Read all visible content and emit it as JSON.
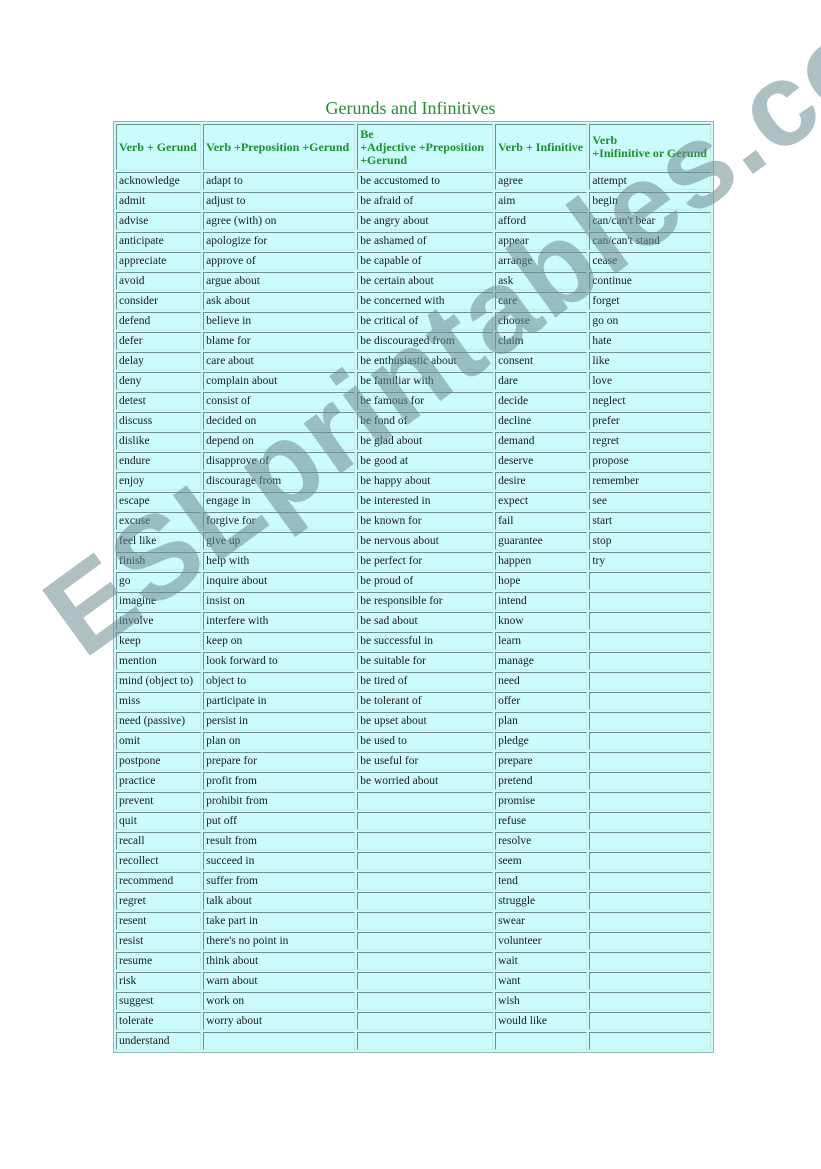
{
  "title": "Gerunds and Infinitives",
  "watermark": "ESLprintables.com",
  "headers": [
    "Verb + Gerund",
    "Verb +Preposition +Gerund",
    "Be +Adjective +Preposition +Gerund",
    "Verb + Infinitive",
    "Verb +Inifinitive or Gerund"
  ],
  "columns": {
    "verb_gerund": [
      "acknowledge",
      "admit",
      "advise",
      "anticipate",
      "appreciate",
      "avoid",
      "consider",
      "defend",
      "defer",
      "delay",
      "deny",
      "detest",
      "discuss",
      "dislike",
      "endure",
      "enjoy",
      "escape",
      "excuse",
      "feel like",
      "finish",
      "go",
      "imagine",
      "involve",
      "keep",
      "mention",
      "mind (object to)",
      "miss",
      "need (passive)",
      "omit",
      "postpone",
      "practice",
      "prevent",
      "quit",
      "recall",
      "recollect",
      "recommend",
      "regret",
      "resent",
      "resist",
      "resume",
      "risk",
      "suggest",
      "tolerate",
      "understand"
    ],
    "verb_prep_gerund": [
      "adapt to",
      "adjust to",
      "agree (with) on",
      " apologize for",
      "approve of",
      "argue about",
      "ask about",
      "believe in",
      "blame for",
      "care about",
      "complain about",
      "consist of",
      "decided on",
      "depend on",
      "disapprove of",
      "discourage from",
      "engage in",
      "forgive for",
      "give up",
      "help with",
      "inquire about",
      "insist on",
      "interfere with",
      "keep on",
      "look forward to",
      "object to",
      "participate in",
      "persist in",
      "plan on",
      "prepare for",
      "profit from",
      "prohibit from",
      "put off",
      "result from",
      "succeed in",
      "suffer from",
      "talk about",
      "take part in",
      "there's no point in",
      "think about",
      "warn about",
      "work on",
      "worry about",
      ""
    ],
    "be_adj_prep_gerund": [
      "be accustomed to",
      "be afraid of",
      "be angry about",
      "be ashamed of",
      "be capable of",
      "be certain about",
      "be concerned with",
      "be critical of",
      "be discouraged from",
      "be enthusiastic about",
      "be familiar with",
      "be famous for",
      "be fond of",
      "be glad about",
      "be good at",
      "be happy about",
      "be interested in",
      "be known for",
      "be nervous about",
      "be perfect for",
      "be proud of",
      "be responsible for",
      "be sad about",
      "be successful in",
      "be suitable for",
      "be tired of",
      "be tolerant of",
      "be upset about",
      "be used to",
      "be useful for",
      "be worried about",
      "",
      "",
      "",
      "",
      "",
      "",
      "",
      "",
      "",
      "",
      "",
      "",
      ""
    ],
    "verb_infinitive": [
      "agree",
      "aim",
      "afford",
      "appear",
      "arrange",
      "ask",
      "care",
      "choose",
      "claim",
      "consent",
      "dare",
      "decide",
      "decline",
      "demand",
      "deserve",
      "desire",
      "expect",
      "fail",
      "guarantee",
      "happen",
      "hope",
      "intend",
      "know",
      "learn",
      "manage",
      "need",
      "offer",
      "plan",
      "pledge",
      "prepare",
      "pretend",
      "promise",
      "refuse",
      "resolve",
      "seem",
      "tend",
      "struggle",
      "swear",
      "volunteer",
      "wait",
      "want",
      "wish",
      "would like",
      ""
    ],
    "verb_inf_or_gerund": [
      "attempt",
      "begin",
      "can/can't bear",
      "can/can't stand",
      "cease",
      "continue",
      "forget",
      "go on",
      "hate",
      "like",
      "love",
      "neglect",
      "prefer",
      "regret",
      "propose",
      "remember",
      "see",
      "start",
      "stop",
      "try",
      "",
      "",
      "",
      "",
      "",
      "",
      "",
      "",
      "",
      "",
      "",
      "",
      "",
      "",
      "",
      "",
      "",
      "",
      "",
      "",
      "",
      "",
      "",
      ""
    ]
  },
  "colors": {
    "header_text": "#1f8f2f",
    "cell_bg": "#ccfbfb",
    "border": "#6f8f94"
  }
}
